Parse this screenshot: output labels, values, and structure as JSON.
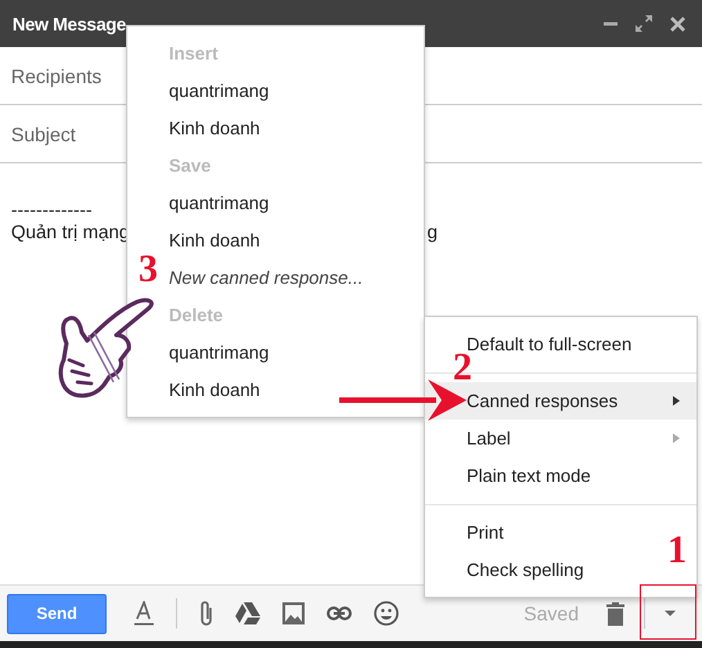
{
  "window": {
    "title": "New Message"
  },
  "fields": [
    {
      "placeholder": "Recipients"
    },
    {
      "placeholder": "Subject"
    }
  ],
  "body": {
    "lines": [
      [
        "-------------"
      ],
      [
        "Quản trị mạng",
        "g"
      ]
    ]
  },
  "footer": {
    "send": "Send",
    "status": "Saved"
  },
  "canned_menu": [
    {
      "heading": "Insert",
      "items": [
        {
          "label": "quantrimang",
          "kind": "plain"
        },
        {
          "label": "Kinh doanh",
          "kind": "plain"
        }
      ]
    },
    {
      "heading": "Save",
      "items": [
        {
          "label": "quantrimang",
          "kind": "plain"
        },
        {
          "label": "Kinh doanh",
          "kind": "plain"
        },
        {
          "label": "New canned response...",
          "kind": "italic"
        }
      ]
    },
    {
      "heading": "Delete",
      "items": [
        {
          "label": "quantrimang",
          "kind": "plain"
        },
        {
          "label": "Kinh doanh",
          "kind": "plain"
        }
      ]
    }
  ],
  "more_menu": [
    [
      {
        "label": "Default to full-screen",
        "submenu": false,
        "selected": false
      }
    ],
    [
      {
        "label": "Canned responses",
        "submenu": true,
        "selected": true
      },
      {
        "label": "Label",
        "submenu": true,
        "selected": false
      },
      {
        "label": "Plain text mode",
        "submenu": false,
        "selected": false
      }
    ],
    [
      {
        "label": "Print",
        "submenu": false,
        "selected": false
      },
      {
        "label": "Check spelling",
        "submenu": false,
        "selected": false
      }
    ]
  ],
  "step_numbers": [
    "1",
    "2",
    "3"
  ]
}
